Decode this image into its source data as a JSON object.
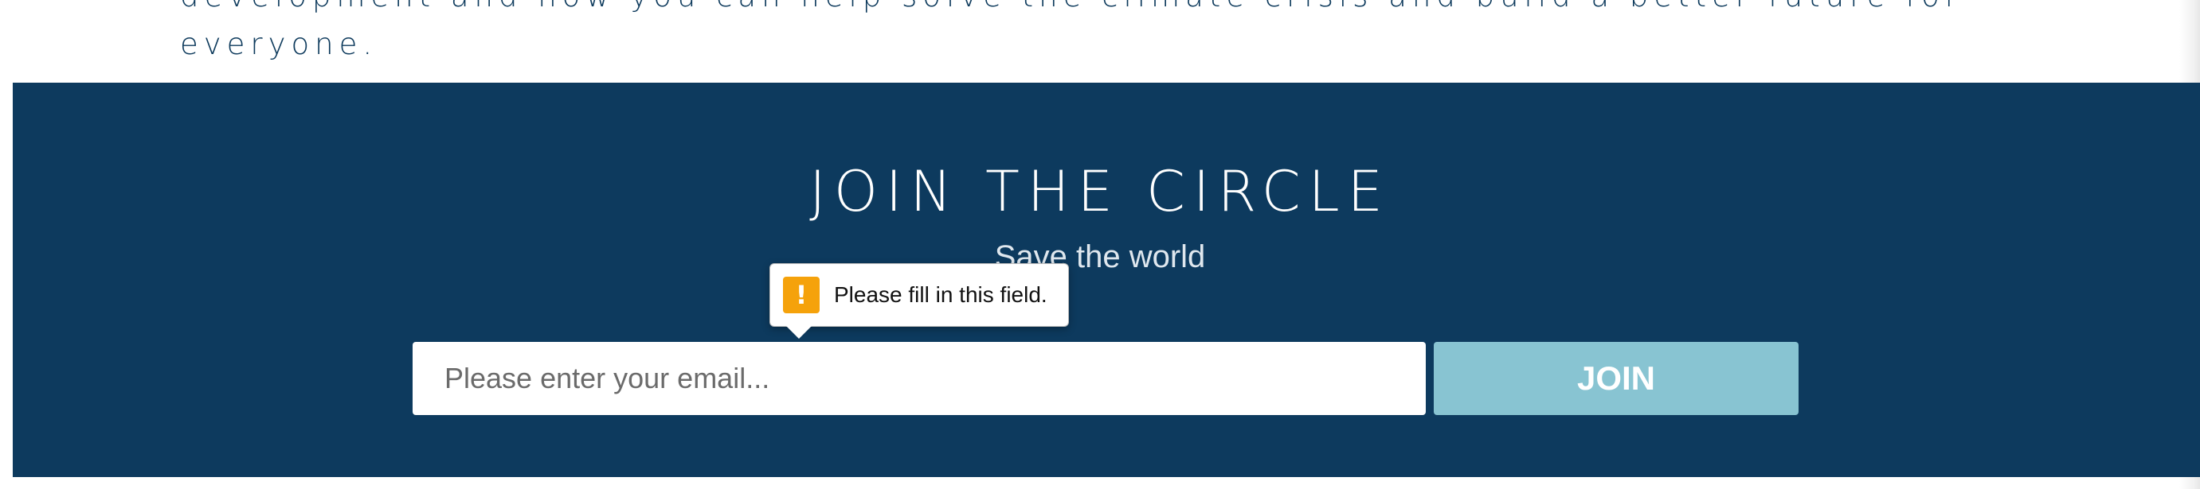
{
  "intro": {
    "line1": "development and how you can help solve the climate crisis and build a better future for",
    "line2": "everyone."
  },
  "signup": {
    "title": "JOIN THE CIRCLE",
    "subtitle": "Save the world",
    "email_placeholder": "Please enter your email...",
    "email_value": "",
    "join_label": "JOIN"
  },
  "validation": {
    "message": "Please fill in this field.",
    "icon": "warning-icon",
    "icon_glyph": "!"
  },
  "colors": {
    "band_background": "#0d3a5e",
    "join_button": "#88c4d2",
    "warning": "#f5a20b",
    "heading_text": "#ffffff"
  }
}
